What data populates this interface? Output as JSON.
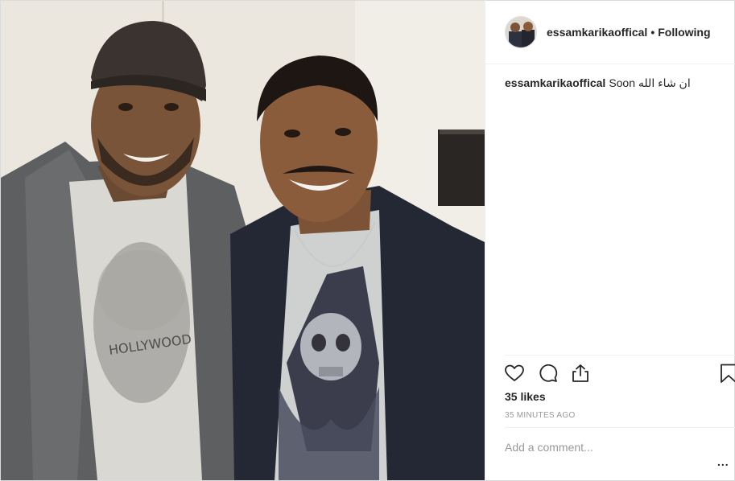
{
  "post": {
    "username": "essamkarikaoffical",
    "separator": "•",
    "follow_status": "Following",
    "caption_user": "essamkarikaoffical",
    "caption_text": "Soon ان شاء الله",
    "likes": "35 likes",
    "timestamp": "35 MINUTES AGO",
    "comment_placeholder": "Add a comment...",
    "more_label": "..."
  },
  "icons": {
    "like": "heart-icon",
    "comment": "speech-bubble-icon",
    "share": "share-icon",
    "save": "bookmark-icon"
  },
  "colors": {
    "text": "#262626",
    "secondary": "#999999",
    "divider": "#efefef"
  }
}
